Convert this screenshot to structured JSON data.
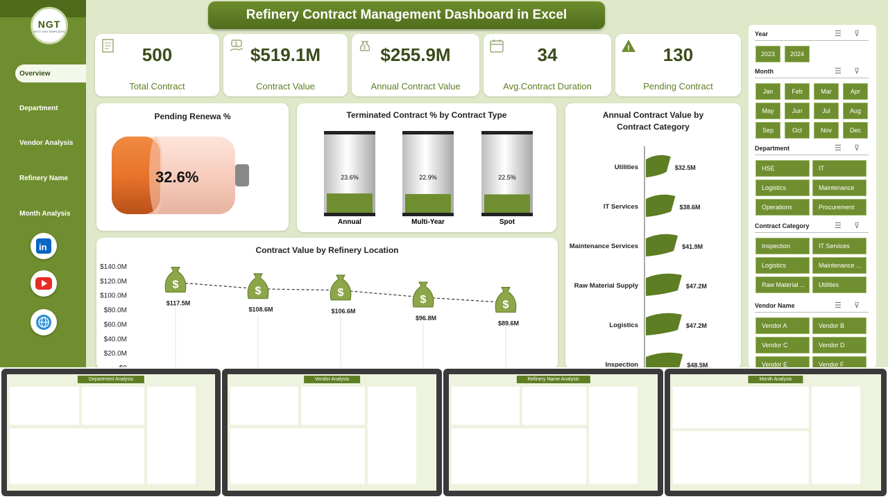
{
  "title": "Refinery Contract Management Dashboard in Excel",
  "logo": {
    "text": "NGT",
    "sub": "NEXT GEN TEMPLATES"
  },
  "nav": [
    "Overview",
    "Department",
    "Vendor Analysis",
    "Refinery Name",
    "Month Analysis"
  ],
  "kpis": [
    {
      "value": "500",
      "label": "Total Contract",
      "icon": "contract-icon"
    },
    {
      "value": "$519.1M",
      "label": "Contract Value",
      "icon": "money-hand-icon"
    },
    {
      "value": "$255.9M",
      "label": "Annual Contract Value",
      "icon": "money-bag-icon"
    },
    {
      "value": "34",
      "label": "Avg.Contract Duration",
      "icon": "calendar-icon"
    },
    {
      "value": "130",
      "label": "Pending Contract",
      "icon": "warning-icon"
    }
  ],
  "pending": {
    "title": "Pending Renewa %",
    "value": "32.6%",
    "fraction": 0.326
  },
  "terminated": {
    "title": "Terminated Contract % by Contract Type",
    "items": [
      {
        "label": "Annual",
        "value": "23.6%",
        "fraction": 0.236
      },
      {
        "label": "Multi-Year",
        "value": "22.9%",
        "fraction": 0.229
      },
      {
        "label": "Spot",
        "value": "22.5%",
        "fraction": 0.225
      }
    ]
  },
  "chart_data": [
    {
      "type": "line",
      "title": "Contract Value by Refinery Location",
      "x": [
        1,
        2,
        3,
        4,
        5
      ],
      "values": [
        117.5,
        108.6,
        106.6,
        96.8,
        89.6
      ],
      "data_labels": [
        "$117.5M",
        "$108.6M",
        "$106.6M",
        "$96.8M",
        "$89.6M"
      ],
      "yticks": [
        "$140.0M",
        "$120.0M",
        "$100.0M",
        "$80.0M",
        "$60.0M",
        "$40.0M",
        "$20.0M",
        "$0"
      ],
      "ylim": [
        0,
        140
      ]
    },
    {
      "type": "bar",
      "title": "Annual Contract Value by Contract Category",
      "categories": [
        "Utilities",
        "IT Services",
        "Maintenance Services",
        "Raw Material Supply",
        "Logistics",
        "Inspection"
      ],
      "values": [
        32.5,
        38.6,
        41.9,
        47.2,
        47.2,
        48.5
      ],
      "data_labels": [
        "$32.5M",
        "$38.6M",
        "$41.9M",
        "$47.2M",
        "$47.2M",
        "$48.5M"
      ]
    }
  ],
  "slicers": {
    "year": {
      "title": "Year",
      "items": [
        "2023",
        "2024"
      ]
    },
    "month": {
      "title": "Month",
      "items": [
        "Jan",
        "Feb",
        "Mar",
        "Apr",
        "May",
        "Jun",
        "Jul",
        "Aug",
        "Sep",
        "Oct",
        "Nov",
        "Dec"
      ]
    },
    "department": {
      "title": "Department",
      "items": [
        "HSE",
        "IT",
        "Logistics",
        "Maintenance",
        "Operations",
        "Procurement"
      ]
    },
    "category": {
      "title": "Contract Category",
      "items": [
        "Inspection",
        "IT Services",
        "Logistics",
        "Maintenance ...",
        "Raw Material ...",
        "Utilities"
      ]
    },
    "vendor": {
      "title": "Vendor Name",
      "items": [
        "Vendor A",
        "Vendor B",
        "Vendor C",
        "Vendor D",
        "Vendor E",
        "Vendor F"
      ]
    }
  },
  "thumbnails": [
    "Department Analysis",
    "Vendor Analysis",
    "Refinery Name Analysis",
    "Month Analysis"
  ],
  "colors": {
    "accent": "#6f8e2f",
    "dark": "#4d6b1a",
    "bg": "#dfe9c9",
    "battery": "#e8742a"
  }
}
